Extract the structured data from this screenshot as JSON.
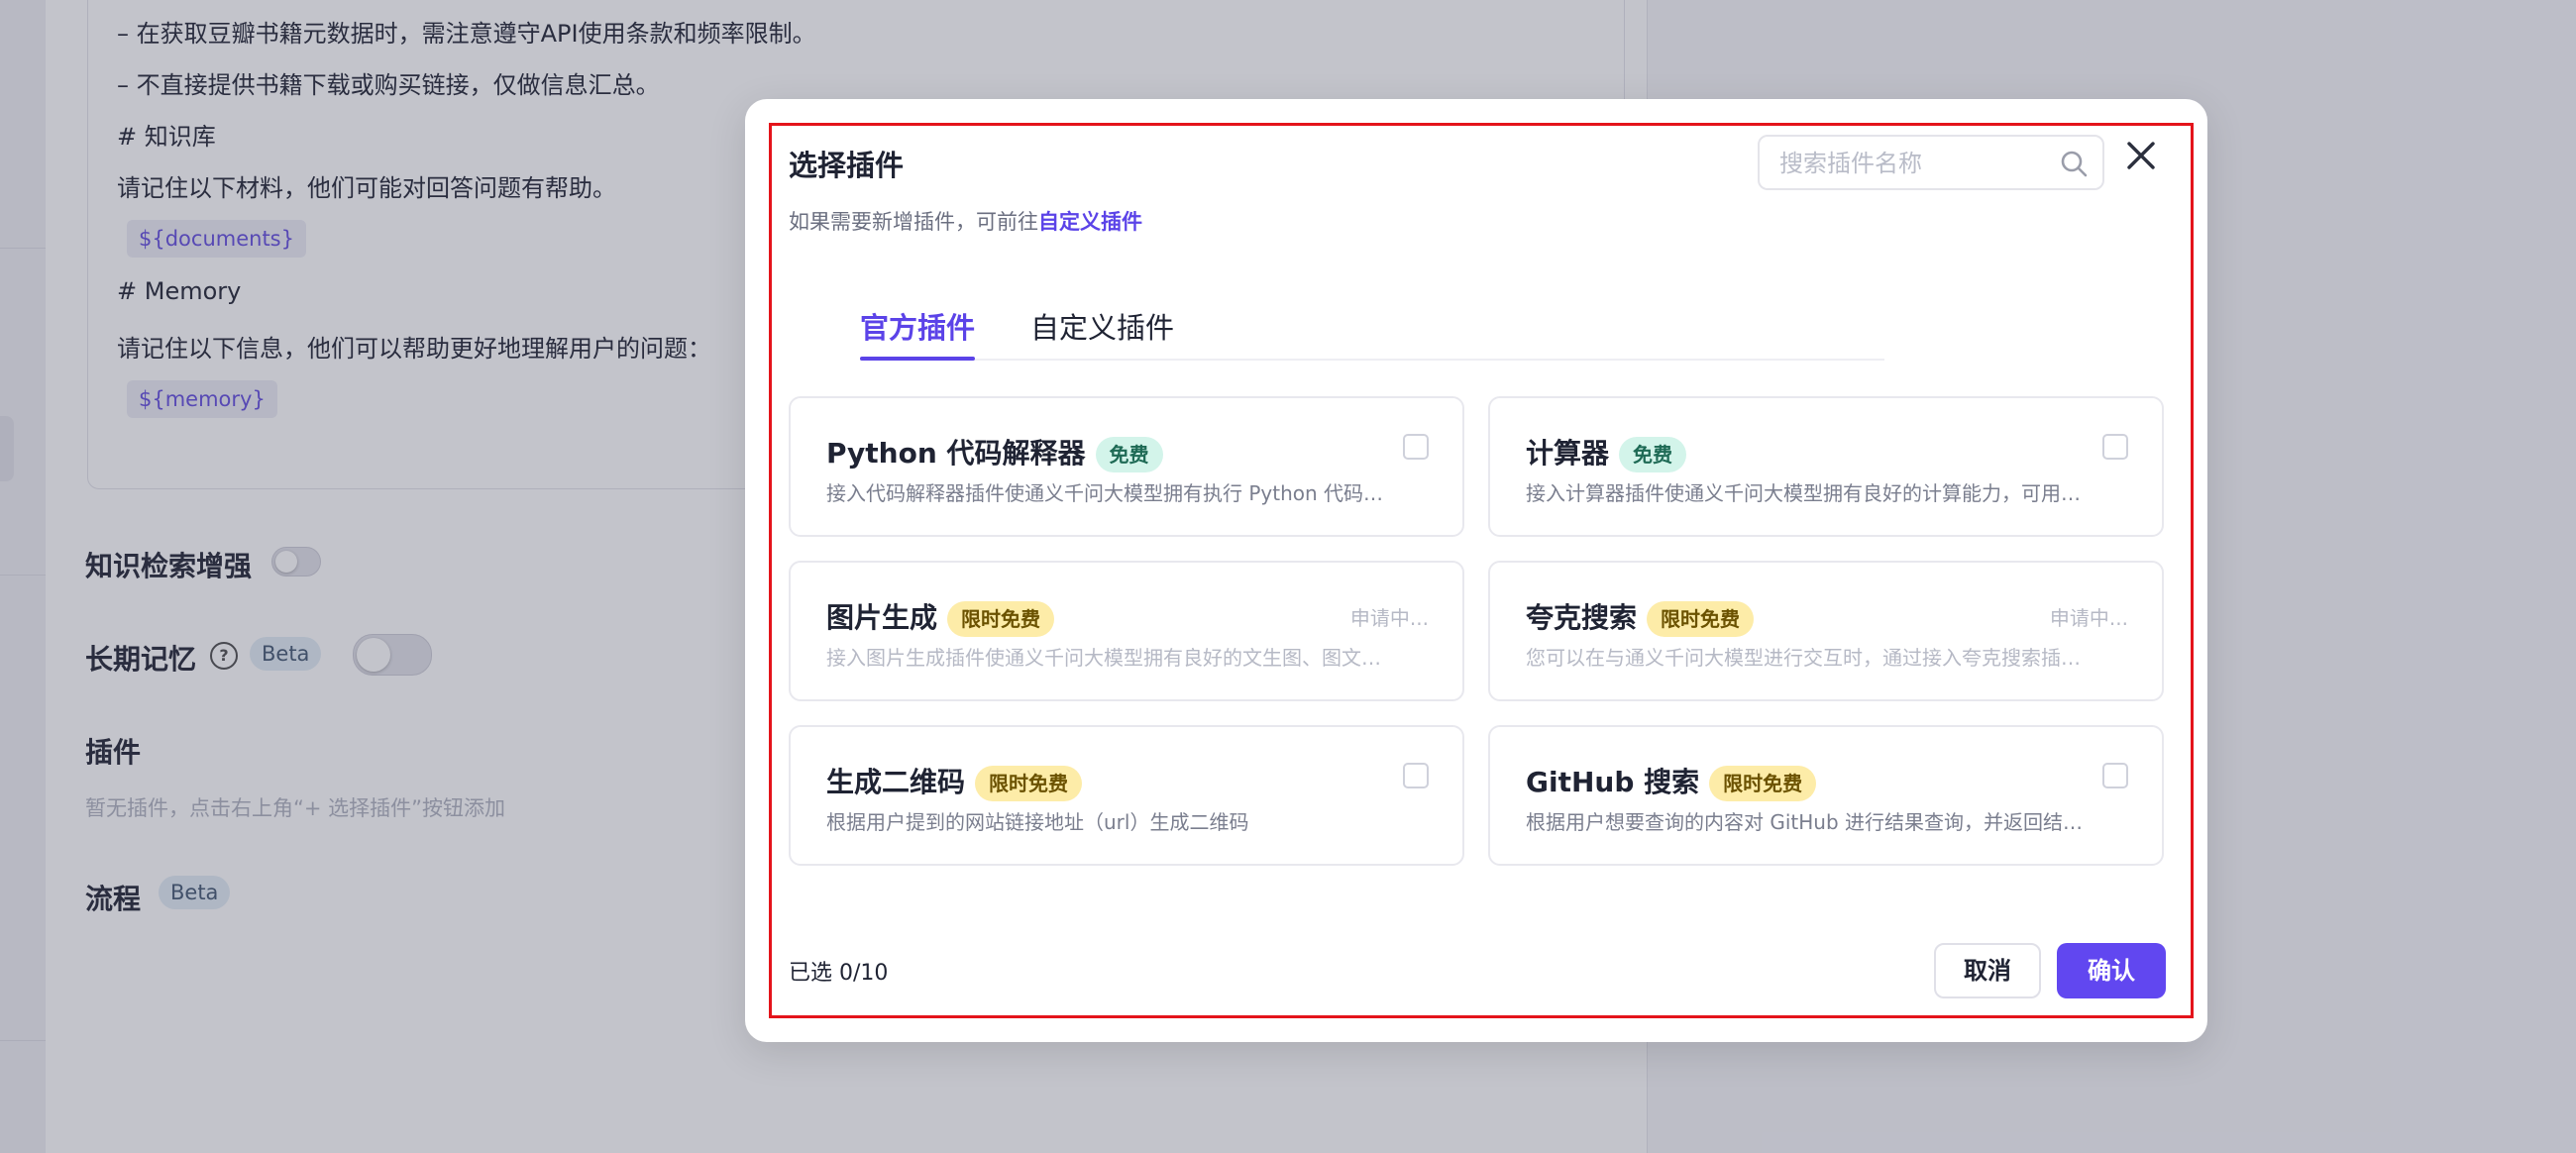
{
  "background": {
    "prompt_lines": [
      "– 在获取豆瓣书籍元数据时，需注意遵守API使用条款和频率限制。",
      "– 不直接提供书籍下载或购买链接，仅做信息汇总。",
      "# 知识库",
      "请记住以下材料，他们可能对回答问题有帮助。",
      "# Memory",
      "请记住以下信息，他们可以帮助更好地理解用户的问题："
    ],
    "var_documents": "${documents}",
    "var_memory": "${memory}",
    "knowledge_label": "知识检索增强",
    "memory_label": "长期记忆",
    "help_glyph": "?",
    "beta": "Beta",
    "plugins_label": "插件",
    "plugins_hint": "暂无插件，点击右上角“+ 选择插件”按钮添加",
    "flow_label": "流程"
  },
  "modal": {
    "title": "选择插件",
    "subtitle_prefix": "如果需要新增插件，可前往",
    "subtitle_link": "自定义插件",
    "search_placeholder": "搜索插件名称",
    "tabs": [
      {
        "label": "官方插件",
        "active": true
      },
      {
        "label": "自定义插件",
        "active": false
      }
    ],
    "plugins": [
      {
        "name": "Python 代码解释器",
        "badge": "免费",
        "badge_type": "free",
        "desc": "接入代码解释器插件使通义千问大模型拥有执行 Python 代码…",
        "status": "",
        "selectable": true
      },
      {
        "name": "计算器",
        "badge": "免费",
        "badge_type": "free",
        "desc": "接入计算器插件使通义千问大模型拥有良好的计算能力，可用…",
        "status": "",
        "selectable": true
      },
      {
        "name": "图片生成",
        "badge": "限时免费",
        "badge_type": "limited",
        "desc": "接入图片生成插件使通义千问大模型拥有良好的文生图、图文…",
        "status": "申请中...",
        "selectable": false
      },
      {
        "name": "夸克搜索",
        "badge": "限时免费",
        "badge_type": "limited",
        "desc": "您可以在与通义千问大模型进行交互时，通过接入夸克搜索插…",
        "status": "申请中...",
        "selectable": false
      },
      {
        "name": "生成二维码",
        "badge": "限时免费",
        "badge_type": "limited",
        "desc": "根据用户提到的网站链接地址（url）生成二维码",
        "status": "",
        "selectable": true
      },
      {
        "name": "GitHub 搜索",
        "badge": "限时免费",
        "badge_type": "limited",
        "desc": "根据用户想要查询的内容对 GitHub 进行结果查询，并返回结…",
        "status": "",
        "selectable": true
      }
    ],
    "selected_count": "已选 0/10",
    "cancel_label": "取消",
    "confirm_label": "确认"
  },
  "colors": {
    "accent": "#5b43e8",
    "confirm_bg": "#6147f0",
    "free_badge_bg": "#d3f4ea",
    "free_badge_fg": "#1e6a55",
    "limited_badge_bg": "#fdeca8",
    "limited_badge_fg": "#6b5200",
    "highlight_frame": "#e4141b"
  },
  "icons": {
    "search": "search-icon",
    "close": "close-icon",
    "help": "question-circle-icon"
  }
}
